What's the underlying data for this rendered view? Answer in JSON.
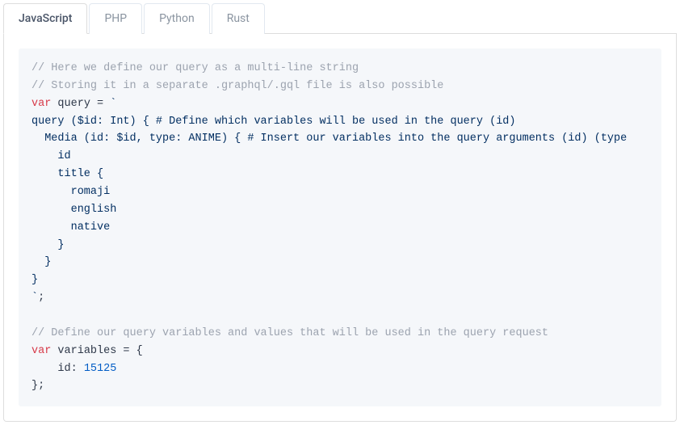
{
  "tabs": [
    {
      "label": "JavaScript",
      "active": true
    },
    {
      "label": "PHP",
      "active": false
    },
    {
      "label": "Python",
      "active": false
    },
    {
      "label": "Rust",
      "active": false
    }
  ],
  "code": {
    "l1": "// Here we define our query as a multi-line string",
    "l2": "// Storing it in a separate .graphql/.gql file is also possible",
    "l3a": "var",
    "l3b": " query = ",
    "l3c": "`",
    "l4": "query ($id: Int) { # Define which variables will be used in the query (id)",
    "l5": "  Media (id: $id, type: ANIME) { # Insert our variables into the query arguments (id) (type",
    "l6": "    id",
    "l7": "    title {",
    "l8": "      romaji",
    "l9": "      english",
    "l10": "      native",
    "l11": "    }",
    "l12": "  }",
    "l13": "}",
    "l14a": "`",
    "l14b": ";",
    "l15": "",
    "l16": "// Define our query variables and values that will be used in the query request",
    "l17a": "var",
    "l17b": " variables = {",
    "l18a": "    id: ",
    "l18b": "15125",
    "l19": "};"
  }
}
